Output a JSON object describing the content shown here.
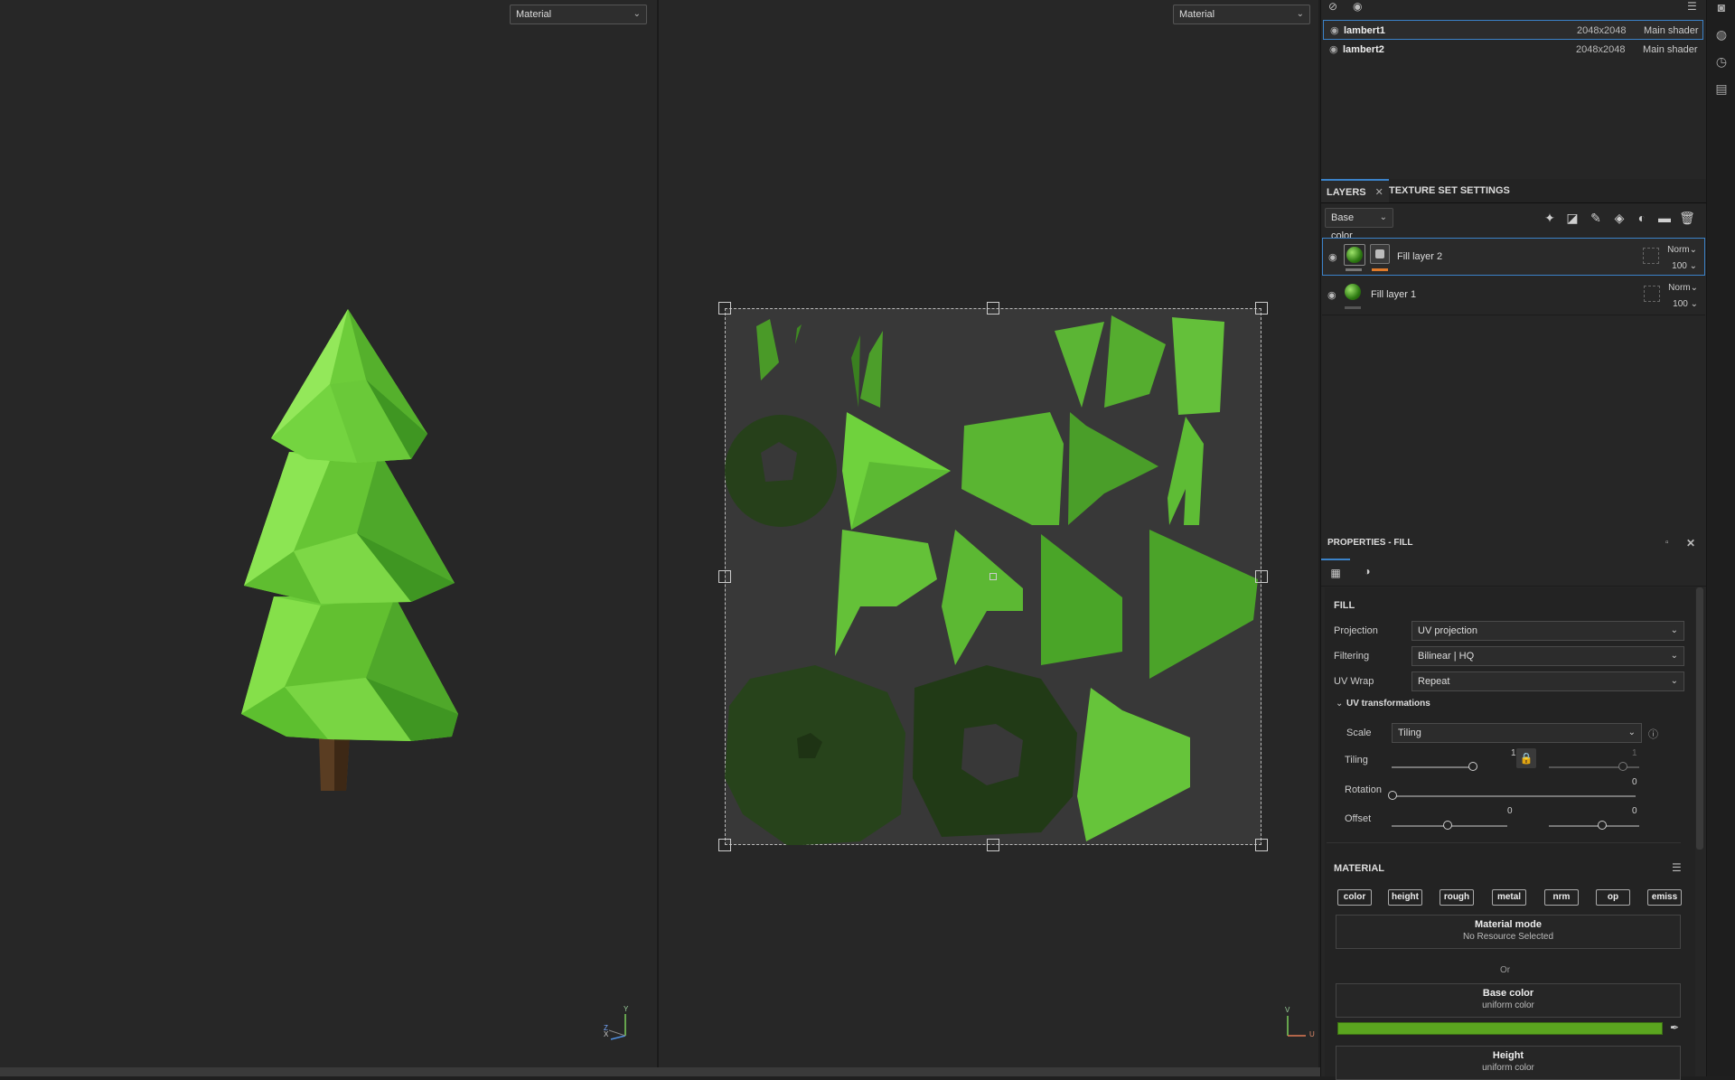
{
  "viewport_left": {
    "mode_select": "Material"
  },
  "viewport_right": {
    "mode_select": "Material"
  },
  "axis_left": {
    "x": "X",
    "y": "Y",
    "z": "Z"
  },
  "axis_right": {
    "v": "V",
    "u": "U"
  },
  "texture_sets": [
    {
      "name": "lambert1",
      "resolution": "2048x2048",
      "shader": "Main shader",
      "selected": true
    },
    {
      "name": "lambert2",
      "resolution": "2048x2048",
      "shader": "Main shader",
      "selected": false
    }
  ],
  "tabs": {
    "layers": "LAYERS",
    "texture_set_settings": "TEXTURE SET SETTINGS",
    "close": "✕"
  },
  "layers_toolbar": {
    "channel_select": "Base color"
  },
  "layers": [
    {
      "name": "Fill layer 2",
      "blend": "Norm",
      "opacity": "100",
      "selected": true
    },
    {
      "name": "Fill layer 1",
      "blend": "Norm",
      "opacity": "100",
      "selected": false
    }
  ],
  "properties": {
    "title": "PROPERTIES - FILL",
    "fill_header": "FILL",
    "projection_label": "Projection",
    "projection_value": "UV projection",
    "filtering_label": "Filtering",
    "filtering_value": "Bilinear | HQ",
    "uvwrap_label": "UV Wrap",
    "uvwrap_value": "Repeat",
    "uv_transformations": "UV transformations",
    "scale_label": "Scale",
    "scale_value": "Tiling",
    "tiling_label": "Tiling",
    "tiling_u": "1",
    "tiling_v": "1",
    "rotation_label": "Rotation",
    "rotation_value": "0",
    "offset_label": "Offset",
    "offset_u": "0",
    "offset_v": "0",
    "material_header": "MATERIAL",
    "channels": [
      "color",
      "height",
      "rough",
      "metal",
      "nrm",
      "op",
      "emiss"
    ],
    "material_mode_title": "Material mode",
    "material_mode_sub": "No Resource Selected",
    "or_text": "Or",
    "base_color_title": "Base color",
    "base_color_sub": "uniform color",
    "base_color_swatch": "#5aa51f",
    "height_title": "Height",
    "height_sub": "uniform color"
  },
  "colors": {
    "accent": "#3b82c8",
    "mask_indicator": "#e07a2a",
    "tree_green": "#6fd23d",
    "trunk": "#5a3d22"
  }
}
